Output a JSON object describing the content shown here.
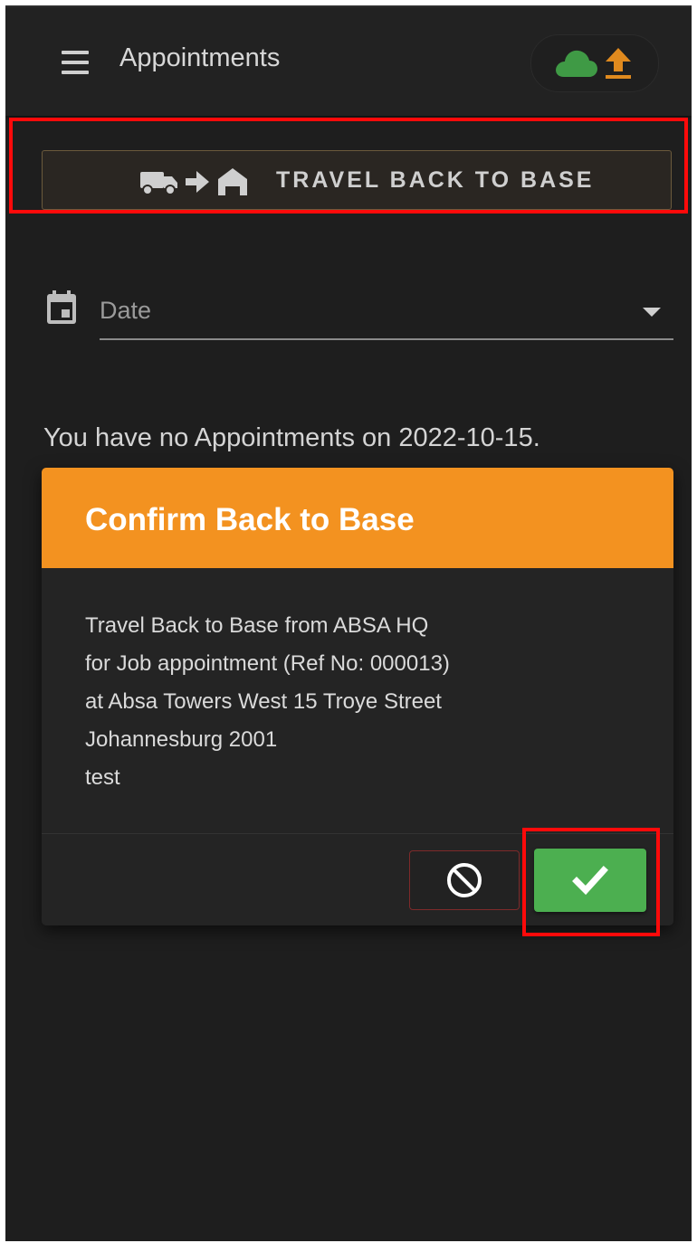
{
  "header": {
    "title": "Appointments",
    "menu_icon": "hamburger-menu-icon",
    "sync_icons": [
      "cloud-icon",
      "upload-arrow-icon"
    ]
  },
  "travel_button": {
    "label": "TRAVEL BACK TO BASE",
    "icons": [
      "truck-icon",
      "arrow-right-icon",
      "home-icon"
    ]
  },
  "date_field": {
    "icon": "calendar-icon",
    "placeholder": "Date"
  },
  "empty_message": "You have no Appointments on 2022-10-15.",
  "dialog": {
    "title": "Confirm Back to Base",
    "message_lines": [
      "Travel Back to Base from ABSA HQ",
      "for Job appointment (Ref No: 000013)",
      "at Absa Towers West 15 Troye Street",
      "Johannesburg 2001",
      "test"
    ],
    "cancel_icon": "block-icon",
    "confirm_icon": "checkmark-icon"
  },
  "colors": {
    "background": "#1e1e1e",
    "dialog_header": "#f39220",
    "confirm": "#4caf50",
    "cancel_border": "#7e2a2a",
    "cloud": "#3f9a45",
    "upload": "#e08a1e",
    "highlight": "#ff0a0a"
  }
}
